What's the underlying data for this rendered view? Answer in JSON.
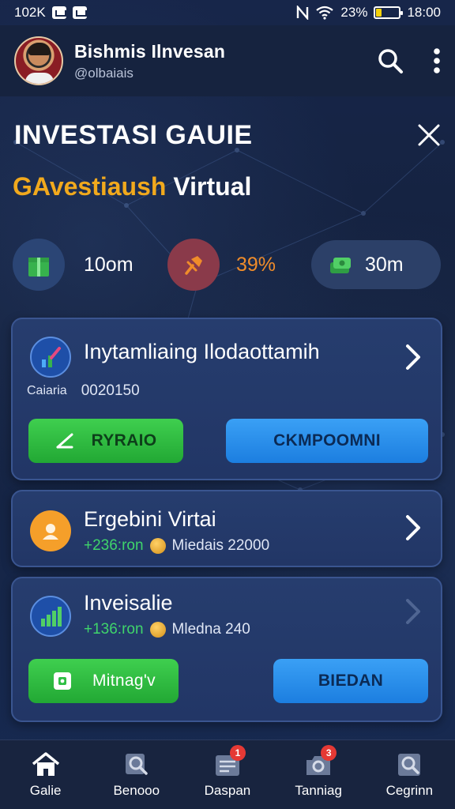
{
  "status_bar": {
    "time_left": "102K",
    "battery_percent": "23%",
    "time_right": "18:00",
    "battery_level": 0.23
  },
  "header": {
    "profile_name": "Bishmis Ilnvesan",
    "profile_handle": "@olbaiais"
  },
  "page": {
    "title": "INVESTASI GAUIE",
    "subtitle_accent": "GAvestiaush",
    "subtitle_plain": "Virtual"
  },
  "stats": [
    {
      "value": "10om",
      "icon": "gift-icon",
      "color": "#37b24d"
    },
    {
      "value": "39%",
      "icon": "pin-icon",
      "color": "#f08c2a"
    },
    {
      "value": "30m",
      "icon": "cash-stack-icon",
      "color": "#51cf66"
    }
  ],
  "cards": [
    {
      "title": "Inytamliaing Ilodaottamih",
      "meta_label": "Caiaria",
      "meta_value": "0020150",
      "buttons": [
        "RYRAIO",
        "CKMPOOMNI"
      ]
    },
    {
      "title": "Ergebini Virtai",
      "meta_green": "+236:ron",
      "meta_value": "Miedais 22000"
    },
    {
      "title": "Inveisalie",
      "meta_green": "+136:ron",
      "meta_value": "Mledna 240",
      "buttons": [
        "Mitnag'v",
        "BIEDAN"
      ]
    }
  ],
  "bottom_nav": [
    {
      "label": "Galie",
      "icon": "home-icon"
    },
    {
      "label": "Benooo",
      "icon": "search-doc-icon"
    },
    {
      "label": "Daspan",
      "icon": "news-icon",
      "badge": "1"
    },
    {
      "label": "Tanniag",
      "icon": "camera-icon",
      "badge": "3"
    },
    {
      "label": "Cegrinn",
      "icon": "search-frame-icon"
    }
  ],
  "colors": {
    "accent": "#f1a91d",
    "green": "#2fbf44",
    "blue": "#2b8ff0",
    "background": "#14213d"
  }
}
